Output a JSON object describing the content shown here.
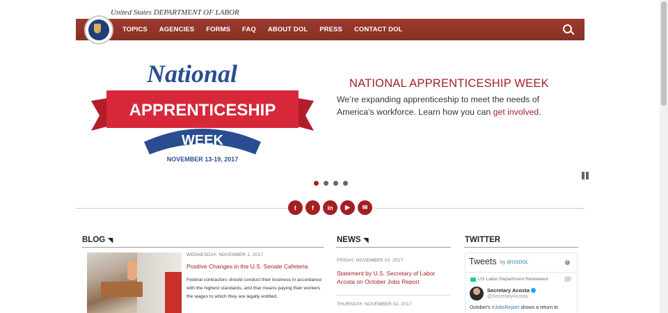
{
  "header": {
    "agency": "United States DEPARTMENT OF LABOR",
    "nav": [
      "TOPICS",
      "AGENCIES",
      "FORMS",
      "FAQ",
      "ABOUT DOL",
      "PRESS",
      "CONTACT DOL"
    ]
  },
  "hero": {
    "logo_line1": "National",
    "logo_line2": "APPRENTICESHIP",
    "logo_line3": "WEEK",
    "logo_line4": "NOVEMBER 13-19, 2017",
    "title": "NATIONAL APPRENTICESHIP WEEK",
    "text": "We’re expanding apprenticeship to meet the needs of America’s workforce. Learn how you can ",
    "link": "get involved",
    "text_end": ".",
    "slide_count": 4,
    "active_slide": 1
  },
  "social": {
    "icons": [
      "twitter-icon",
      "facebook-icon",
      "linkedin-icon",
      "youtube-icon",
      "email-icon"
    ],
    "glyphs": [
      "t",
      "f",
      "in",
      "▶",
      "✉"
    ]
  },
  "blog": {
    "heading": "BLOG",
    "date": "WEDNESDAY, NOVEMBER 1, 2017",
    "title": "Positive Changes in the U.S. Senate Cafeteria",
    "body": "Federal contractors should conduct their business in accordance with the highest standards, and that means paying their workers the wages to which they are legally entitled."
  },
  "news": {
    "heading": "NEWS",
    "items": [
      {
        "date": "FRIDAY, NOVEMBER 03, 2017",
        "title": "Statement by U.S. Secretary of Labor Acosta on October Jobs Report"
      },
      {
        "date": "THURSDAY, NOVEMBER 02, 2017",
        "title": ""
      }
    ]
  },
  "twitter": {
    "heading": "TWITTER",
    "tweets_label": "Tweets",
    "by_label": "by",
    "by_handle": "@USDOL",
    "retweeted": "US Labor Department Retweeted",
    "name": "Secretary Acosta",
    "handle": "@SecretaryAcosta",
    "text_start": "October's ",
    "hashtag": "#JobsReport",
    "text_end": " shows a return to"
  },
  "colors": {
    "brand": "#96352a",
    "accent": "#a41e23"
  }
}
